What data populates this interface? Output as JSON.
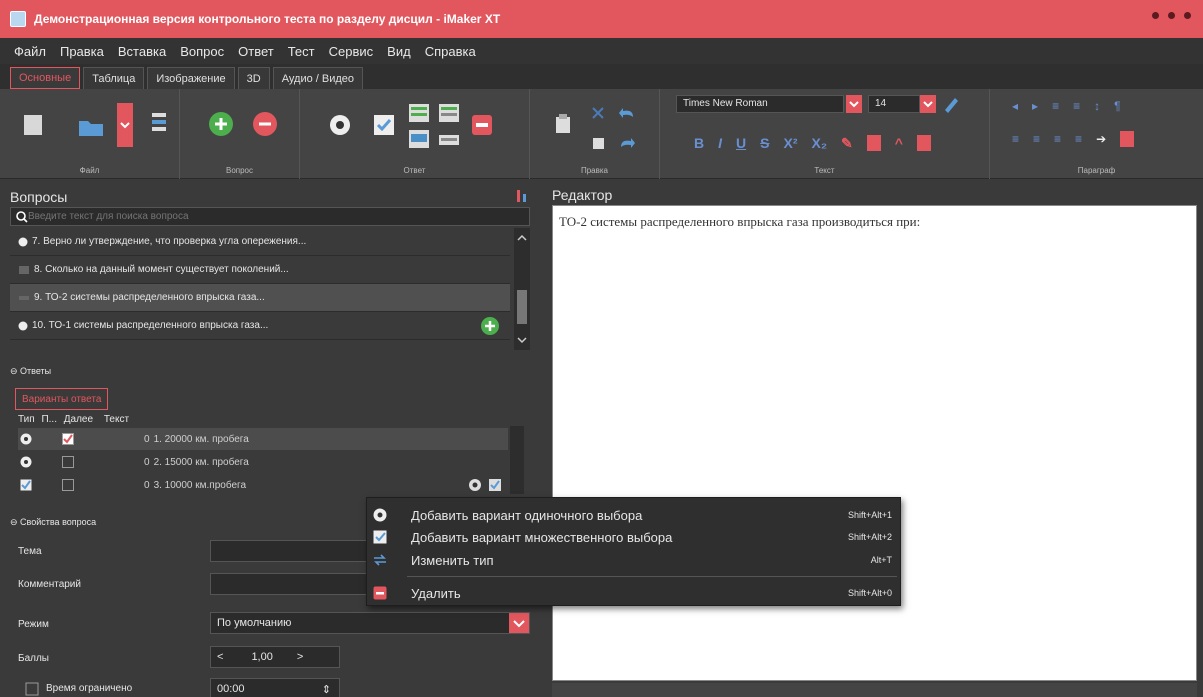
{
  "window": {
    "title": "Демонстрационная версия контрольного теста по разделу дисцил - iMaker XT"
  },
  "menu": [
    "Файл",
    "Правка",
    "Вставка",
    "Вопрос",
    "Ответ",
    "Тест",
    "Сервис",
    "Вид",
    "Справка"
  ],
  "ribbon_tabs": [
    "Основные",
    "Таблица",
    "Изображение",
    "3D",
    "Аудио / Видео"
  ],
  "ribbon": {
    "groups": [
      "Файл",
      "Вопрос",
      "Ответ",
      "Правка",
      "Текст",
      "Параграф"
    ],
    "font_name": "Times New Roman",
    "font_size": "14",
    "accent_color": "#e2575e"
  },
  "questions_panel": {
    "title": "Вопросы",
    "search_placeholder": "Введите текст для поиска вопроса",
    "items": [
      "7. Верно ли утверждение, что проверка угла опережения...",
      "8. Сколько на данный момент существует поколений...",
      "9. ТО-2 системы распределенного впрыска газа...",
      "10. ТО-1 системы распределенного впрыска газа..."
    ]
  },
  "answers": {
    "section_title": "Ответы",
    "tab_label": "Варианты ответа",
    "columns": [
      "Тип",
      "П...",
      "Далее",
      "Текст"
    ],
    "rows": [
      {
        "next": "0",
        "text": "1. 20000 км. пробега"
      },
      {
        "next": "0",
        "text": "2. 15000 км. пробега"
      },
      {
        "next": "0",
        "text": "3. 10000 км.пробега"
      }
    ]
  },
  "properties": {
    "section_title": "Свойства вопроса",
    "topic_label": "Тема",
    "comment_label": "Комментарий",
    "mode_label": "Режим",
    "mode_value": "По умолчанию",
    "score_label": "Баллы",
    "score_value": "1,00",
    "time_label": "Время ограничено",
    "time_value": "00:00"
  },
  "editor": {
    "title": "Редактор",
    "text": "ТО-2 системы распределенного впрыска газа производиться при:"
  },
  "context_menu": [
    {
      "label": "Добавить вариант одиночного выбора",
      "shortcut": "Shift+Alt+1",
      "icon": "radio-icon"
    },
    {
      "label": "Добавить вариант множественного выбора",
      "shortcut": "Shift+Alt+2",
      "icon": "checkbox-icon"
    },
    {
      "label": "Изменить тип",
      "shortcut": "Alt+T",
      "icon": "swap-arrows-icon"
    },
    {
      "label": "Удалить",
      "shortcut": "Shift+Alt+0",
      "icon": "delete-icon"
    }
  ]
}
